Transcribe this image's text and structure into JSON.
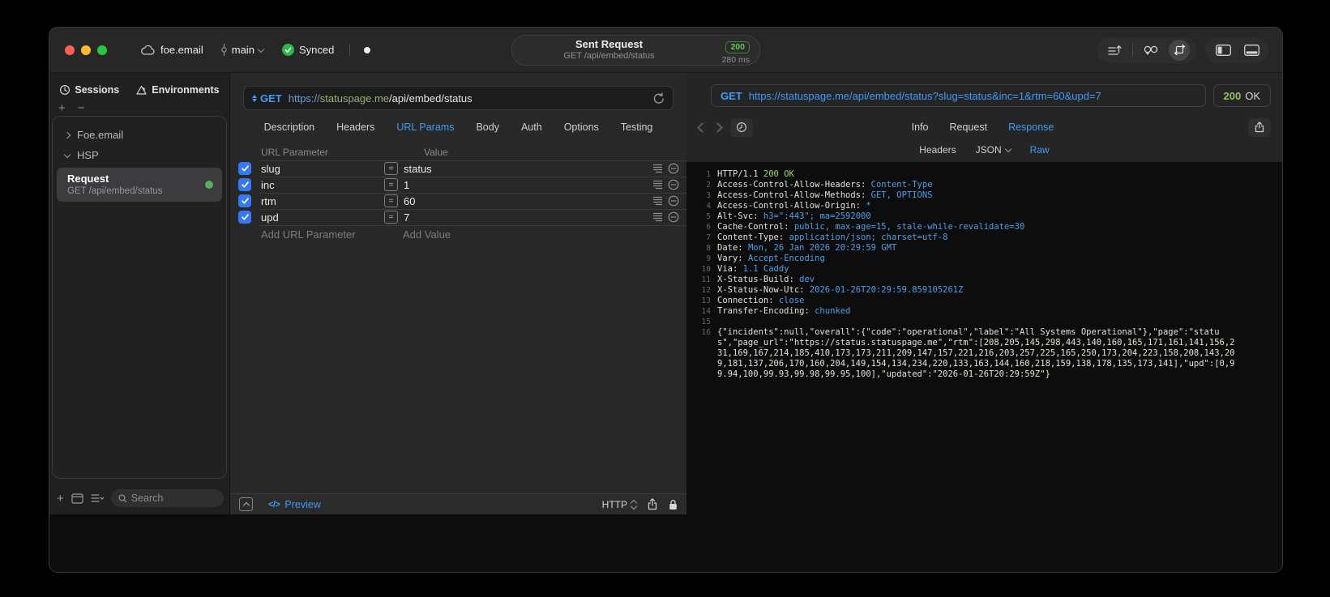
{
  "titlebar": {
    "project": "foe.email",
    "branch": "main",
    "synced_label": "Synced",
    "request_pill": {
      "title": "Sent Request",
      "subtitle": "GET /api/embed/status",
      "status_code": "200",
      "duration": "280 ms"
    }
  },
  "sidebar": {
    "tabs": [
      {
        "label": "Sessions"
      },
      {
        "label": "Environments"
      }
    ],
    "tree": {
      "foe_item": "Foe.email",
      "hsp_item": "HSP",
      "request": {
        "title": "Request",
        "subtitle": "GET /api/embed/status"
      }
    },
    "search_placeholder": "Search"
  },
  "editor": {
    "method": "GET",
    "url": {
      "scheme": "https://",
      "host": "statuspage.me",
      "path": "/api/embed/status"
    },
    "tabs": [
      "Description",
      "Headers",
      "URL Params",
      "Body",
      "Auth",
      "Options",
      "Testing"
    ],
    "active_tab": "URL Params",
    "table": {
      "col_param": "URL Parameter",
      "col_value": "Value",
      "rows": [
        {
          "name": "slug",
          "value": "status"
        },
        {
          "name": "inc",
          "value": "1"
        },
        {
          "name": "rtm",
          "value": "60"
        },
        {
          "name": "upd",
          "value": "7"
        }
      ],
      "add_param": "Add URL Parameter",
      "add_value": "Add Value"
    },
    "footer": {
      "preview_icon": "</>",
      "preview": "Preview",
      "protocol": "HTTP"
    }
  },
  "response": {
    "method": "GET",
    "url": "https://statuspage.me/api/embed/status?slug=status&inc=1&rtm=60&upd=7",
    "status_code": "200",
    "status_text": "OK",
    "tabs": [
      "Info",
      "Request",
      "Response"
    ],
    "active_tab": "Response",
    "subtabs": [
      "Headers",
      "JSON",
      "Raw"
    ],
    "active_subtab": "Raw",
    "status_line": {
      "protocol": "HTTP/1.1",
      "status": "200 OK"
    },
    "headers": [
      {
        "name": "Access-Control-Allow-Headers",
        "value": "Content-Type"
      },
      {
        "name": "Access-Control-Allow-Methods",
        "value": "GET, OPTIONS"
      },
      {
        "name": "Access-Control-Allow-Origin",
        "value": "*"
      },
      {
        "name": "Alt-Svc",
        "value": "h3=\":443\"; ma=2592000"
      },
      {
        "name": "Cache-Control",
        "value": "public, max-age=15, stale-while-revalidate=30"
      },
      {
        "name": "Content-Type",
        "value": "application/json; charset=utf-8"
      },
      {
        "name": "Date",
        "value": "Mon, 26 Jan 2026 20:29:59 GMT"
      },
      {
        "name": "Vary",
        "value": "Accept-Encoding"
      },
      {
        "name": "Via",
        "value": "1.1 Caddy"
      },
      {
        "name": "X-Status-Build",
        "value": "dev"
      },
      {
        "name": "X-Status-Now-Utc",
        "value": "2026-01-26T20:29:59.859105261Z"
      },
      {
        "name": "Connection",
        "value": "close"
      },
      {
        "name": "Transfer-Encoding",
        "value": "chunked"
      }
    ],
    "body": "{\"incidents\":null,\"overall\":{\"code\":\"operational\",\"label\":\"All Systems Operational\"},\"page\":\"status\",\"page_url\":\"https://status.statuspage.me\",\"rtm\":[208,205,145,298,443,140,160,165,171,161,141,156,231,169,167,214,185,410,173,173,211,209,147,157,221,216,203,257,225,165,250,173,204,223,158,208,143,209,181,137,206,170,160,204,149,154,134,234,220,133,163,144,160,218,159,138,178,135,173,141],\"upd\":[0,99.94,100,99.93,99.98,99.95,100],\"updated\":\"2026-01-26T20:29:59Z\"}"
  },
  "colors": {
    "accent_blue": "#3f9bf7",
    "header_value_blue": "#4aa0e8",
    "status_green": "#9fd254",
    "checkbox_blue": "#3478f6",
    "traffic_red": "#ff5f57",
    "traffic_yellow": "#febc2e",
    "traffic_green": "#28c840"
  }
}
